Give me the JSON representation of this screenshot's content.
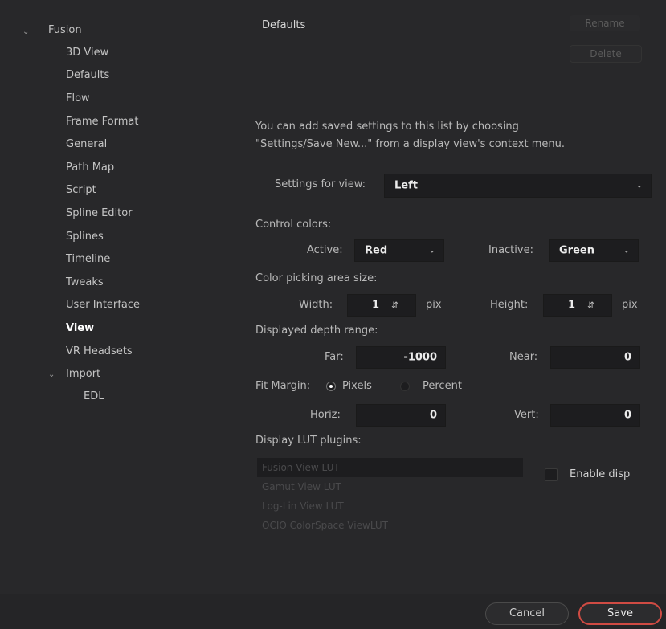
{
  "sidebar": {
    "root": {
      "label": "Fusion",
      "expanded": true
    },
    "items": [
      {
        "label": "3D View",
        "selected": false
      },
      {
        "label": "Defaults",
        "selected": false
      },
      {
        "label": "Flow",
        "selected": false
      },
      {
        "label": "Frame Format",
        "selected": false
      },
      {
        "label": "General",
        "selected": false
      },
      {
        "label": "Path Map",
        "selected": false
      },
      {
        "label": "Script",
        "selected": false
      },
      {
        "label": "Spline Editor",
        "selected": false
      },
      {
        "label": "Splines",
        "selected": false
      },
      {
        "label": "Timeline",
        "selected": false
      },
      {
        "label": "Tweaks",
        "selected": false
      },
      {
        "label": "User Interface",
        "selected": false
      },
      {
        "label": "View",
        "selected": true
      },
      {
        "label": "VR Headsets",
        "selected": false
      }
    ],
    "import": {
      "label": "Import",
      "expanded": true,
      "children": [
        {
          "label": "EDL"
        }
      ]
    }
  },
  "panel": {
    "list_title": "Defaults",
    "rename_label": "Rename",
    "delete_label": "Delete",
    "help_line1": "You can add saved settings to this list by choosing",
    "help_line2": "\"Settings/Save New...\" from a display view's context menu.",
    "settings_for_view": {
      "label": "Settings for view:",
      "value": "Left"
    },
    "control_colors": {
      "heading": "Control colors:",
      "active_label": "Active:",
      "active_value": "Red",
      "inactive_label": "Inactive:",
      "inactive_value": "Green"
    },
    "color_picking": {
      "heading": "Color picking area size:",
      "width_label": "Width:",
      "width_value": "1",
      "height_label": "Height:",
      "height_value": "1",
      "unit": "pix"
    },
    "depth_range": {
      "heading": "Displayed depth range:",
      "far_label": "Far:",
      "far_value": "-1000",
      "near_label": "Near:",
      "near_value": "0"
    },
    "fit_margin": {
      "label": "Fit Margin:",
      "option_pixels": "Pixels",
      "option_percent": "Percent",
      "selected": "Pixels",
      "horiz_label": "Horiz:",
      "horiz_value": "0",
      "vert_label": "Vert:",
      "vert_value": "0"
    },
    "lut": {
      "heading": "Display LUT plugins:",
      "items": [
        "Fusion View LUT",
        "Gamut View LUT",
        "Log-Lin View LUT",
        "OCIO ColorSpace ViewLUT"
      ],
      "enable_label": "Enable disp",
      "enabled": false
    }
  },
  "footer": {
    "cancel_label": "Cancel",
    "save_label": "Save"
  },
  "colors": {
    "background": "#28282a",
    "field": "#1d1d1f",
    "accent": "#d04b43"
  },
  "icons": {
    "expand": "chevron-down-icon",
    "dropdown": "chevron-down-icon",
    "spin": "spinner-arrows-icon"
  }
}
